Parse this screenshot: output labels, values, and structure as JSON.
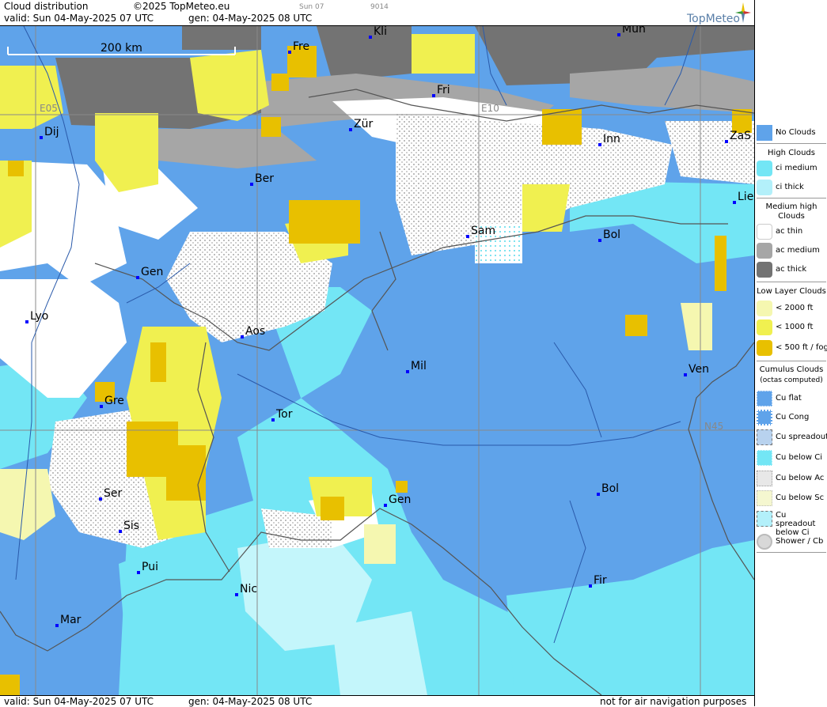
{
  "header": {
    "title": "Cloud distribution",
    "copyright": "©2025 TopMeteo.eu",
    "day_label": "Sun 07",
    "code": "9014",
    "valid": "valid:  Sun  04-May-2025  07 UTC",
    "gen": "gen: 04-May-2025 08 UTC",
    "logo": "TopMeteo"
  },
  "footer": {
    "valid": "valid:  Sun  04-May-2025  07 UTC",
    "gen": "gen: 04-May-2025 08 UTC",
    "disclaimer": "not for air navigation purposes"
  },
  "map": {
    "scale_label": "200 km",
    "grid_labels": {
      "e05": "E05",
      "e10": "E10",
      "n45": "N45"
    },
    "cities": [
      {
        "name": "Mun"
      },
      {
        "name": "Kli"
      },
      {
        "name": "Fre"
      },
      {
        "name": "Fri"
      },
      {
        "name": "Zür"
      },
      {
        "name": "Dij"
      },
      {
        "name": "Inn"
      },
      {
        "name": "ZaS"
      },
      {
        "name": "Ber"
      },
      {
        "name": "Lie"
      },
      {
        "name": "Sam"
      },
      {
        "name": "Bol"
      },
      {
        "name": "Gen"
      },
      {
        "name": "Lyo"
      },
      {
        "name": "Aos"
      },
      {
        "name": "Mil"
      },
      {
        "name": "Ven"
      },
      {
        "name": "Gre"
      },
      {
        "name": "Tor"
      },
      {
        "name": "Ser"
      },
      {
        "name": "Gen"
      },
      {
        "name": "Bol"
      },
      {
        "name": "Sis"
      },
      {
        "name": "Pui"
      },
      {
        "name": "Nic"
      },
      {
        "name": "Fir"
      },
      {
        "name": "Mar"
      }
    ]
  },
  "legend": {
    "no_clouds": "No Clouds",
    "high_title": "High Clouds",
    "ci_medium": "ci medium",
    "ci_thick": "ci thick",
    "medium_title": "Medium high Clouds",
    "ac_thin": "ac thin",
    "ac_medium": "ac medium",
    "ac_thick": "ac thick",
    "low_title": "Low Layer Clouds",
    "low_2000": "< 2000 ft",
    "low_1000": "< 1000 ft",
    "low_500": "< 500 ft / fog",
    "cumulus_title": "Cumulus Clouds",
    "cumulus_sub": "(octas computed)",
    "cu_flat": "Cu flat",
    "cu_cong": "Cu Cong",
    "cu_spreadout": "Cu spreadout",
    "cu_below_ci": "Cu below Ci",
    "cu_below_ac": "Cu below Ac",
    "cu_below_sc": "Cu below Sc",
    "cu_spreadout_below_ci": "Cu spreadout below Ci",
    "shower_cb": "Shower / Cb"
  },
  "colors": {
    "no_clouds": "#5fa3ea",
    "ci_medium": "#73e6f5",
    "ci_thick": "#b3f0fa",
    "ac_thin": "#ffffff",
    "ac_medium": "#a6a6a6",
    "ac_thick": "#737373",
    "low_2000": "#f5f7b0",
    "low_1000": "#f0f050",
    "low_500": "#e8c000"
  }
}
